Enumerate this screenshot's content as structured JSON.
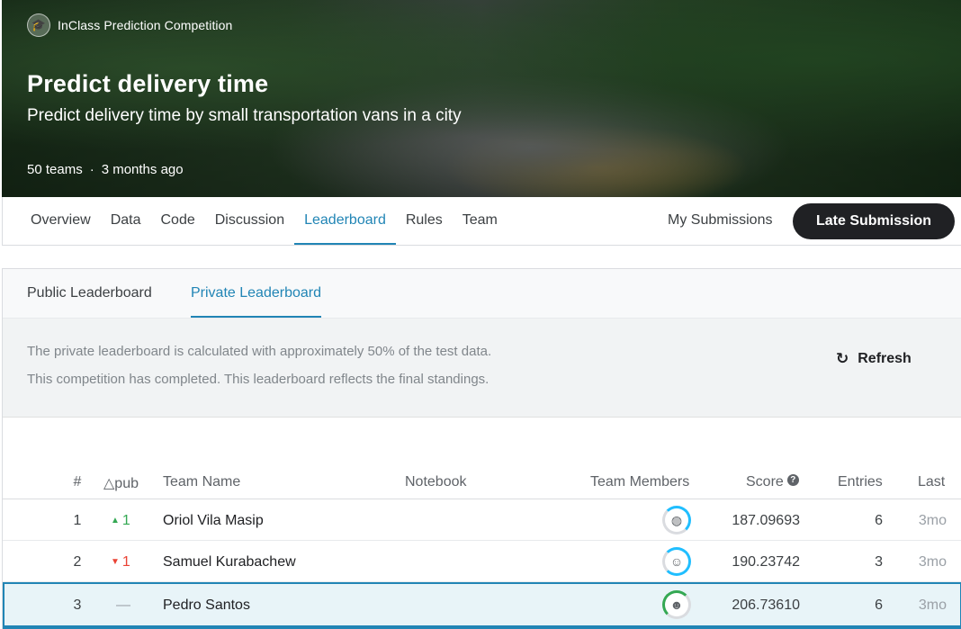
{
  "hero": {
    "badge": "InClass Prediction Competition",
    "title": "Predict delivery time",
    "subtitle": "Predict delivery time by small transportation vans in a city",
    "teams": "50 teams",
    "separator": "·",
    "ago": "3 months ago"
  },
  "nav": {
    "tabs": [
      "Overview",
      "Data",
      "Code",
      "Discussion",
      "Leaderboard",
      "Rules",
      "Team"
    ],
    "active_tab": "Leaderboard",
    "my_submissions": "My Submissions",
    "late_submission": "Late Submission"
  },
  "leaderboard": {
    "tabs": [
      "Public Leaderboard",
      "Private Leaderboard"
    ],
    "active_tab": "Private Leaderboard",
    "info_line1": "The private leaderboard is calculated with approximately 50% of the test data.",
    "info_line2": "This competition has completed. This leaderboard reflects the final standings.",
    "refresh_label": "Refresh",
    "columns": {
      "rank": "#",
      "delta": "△pub",
      "team": "Team Name",
      "notebook": "Notebook",
      "members": "Team Members",
      "score": "Score",
      "entries": "Entries",
      "last": "Last"
    },
    "rows": [
      {
        "rank": "1",
        "delta": "1",
        "direction": "up",
        "team": "Oriol Vila Masip",
        "score": "187.09693",
        "entries": "6",
        "last": "3mo"
      },
      {
        "rank": "2",
        "delta": "1",
        "direction": "down",
        "team": "Samuel Kurabachew",
        "score": "190.23742",
        "entries": "3",
        "last": "3mo"
      },
      {
        "rank": "3",
        "delta": "—",
        "direction": "none",
        "team": "Pedro Santos",
        "score": "206.73610",
        "entries": "6",
        "last": "3mo"
      }
    ]
  },
  "colors": {
    "accent": "#2185b5",
    "up": "#34a853",
    "down": "#ea4335",
    "button": "#202124"
  }
}
